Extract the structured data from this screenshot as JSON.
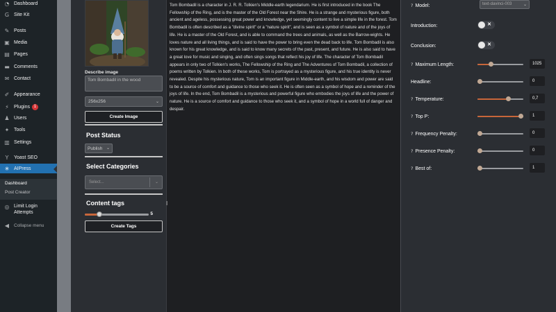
{
  "wp_menu": {
    "items": [
      {
        "label": "Dashboard",
        "icon": "gauge-icon"
      },
      {
        "label": "Site Kit",
        "icon": "g-icon"
      },
      {
        "label": "Posts",
        "icon": "pin-icon"
      },
      {
        "label": "Media",
        "icon": "media-icon"
      },
      {
        "label": "Pages",
        "icon": "page-icon"
      },
      {
        "label": "Comments",
        "icon": "comment-icon"
      },
      {
        "label": "Contact",
        "icon": "mail-icon"
      },
      {
        "label": "Appearance",
        "icon": "brush-icon"
      },
      {
        "label": "Plugins",
        "icon": "plug-icon",
        "badge": "1"
      },
      {
        "label": "Users",
        "icon": "user-icon"
      },
      {
        "label": "Tools",
        "icon": "wrench-icon"
      },
      {
        "label": "Settings",
        "icon": "settings-icon"
      },
      {
        "label": "Yoast SEO",
        "icon": "yoast-icon"
      },
      {
        "label": "AIPress",
        "icon": "aipress-icon"
      }
    ],
    "sub_items": [
      "Dashboard",
      "Post Creator"
    ],
    "limit_login": "Limit Login Attempts",
    "collapse": "Collapse menu"
  },
  "left_panel": {
    "describe_label": "Describe image",
    "describe_value": "Tom Bombadil in the wood",
    "size_value": "256x256",
    "create_image_label": "Create Image",
    "post_status_title": "Post Status",
    "post_status_value": "Publish",
    "categories_title": "Select Categories",
    "categories_placeholder": "Select...",
    "content_tags_title": "Content tags",
    "tags_value": "5",
    "tags_fraction": 0.2,
    "create_tags_label": "Create Tags"
  },
  "content": {
    "text": "Tom Bombadil is a character in J. R. R. Tolkien's Middle-earth legendarium. He is first introduced in the book The Fellowship of the Ring, and is the master of the Old Forest near the Shire. He is a strange and mysterious figure, both ancient and ageless, possessing great power and knowledge, yet seemingly content to live a simple life in the forest. Tom Bombadil is often described as a \"divine spirit\" or a \"nature spirit\", and is seen as a symbol of nature and of the joys of life. He is a master of the Old Forest, and is able to command the trees and animals, as well as the Barrow-wights. He loves nature and all living things, and is said to have the power to bring even the dead back to life. Tom Bombadil is also known for his great knowledge, and is said to know many secrets of the past, present, and future. He is also said to have a great love for music and singing, and often sings songs that reflect his joy of life. The character of Tom Bombadil appears in only two of Tolkien's works, The Fellowship of the Ring and The Adventures of Tom Bombadil, a collection of poems written by Tolkien. In both of these works, Tom is portrayed as a mysterious figure, and his true identity is never revealed. Despite his mysterious nature, Tom is an important figure in Middle-earth, and his wisdom and power are said to be a source of comfort and guidance to those who seek it. He is often seen as a symbol of hope and a reminder of the joys of life. In the end, Tom Bombadil is a mysterious and powerful figure who embodies the joys of life and the power of nature. He is a source of comfort and guidance to those who seek it, and a symbol of hope in a world full of danger and despair."
  },
  "settings": {
    "model_label": "Model:",
    "model_value": "text-davinci-003",
    "introduction_label": "Introduction:",
    "conclusion_label": "Conclusion:",
    "sliders": [
      {
        "label": "Maximum Length:",
        "value": "1025",
        "fraction": 0.27
      },
      {
        "label": "Headline:",
        "value": "0",
        "fraction": 0.0
      },
      {
        "label": "Temperature:",
        "value": "0,7",
        "fraction": 0.7
      },
      {
        "label": "Top P:",
        "value": "1",
        "fraction": 1.0
      },
      {
        "label": "Frequency Penalty:",
        "value": "0",
        "fraction": 0.0
      },
      {
        "label": "Presence Penalty:",
        "value": "0",
        "fraction": 0.0
      },
      {
        "label": "Best of:",
        "value": "1",
        "fraction": 0.0
      }
    ],
    "q_marks": [
      "?",
      "?",
      "?",
      "?",
      "?",
      "?",
      "?",
      "?"
    ]
  },
  "colors": {
    "accent_orange": "#c8663a",
    "wp_blue": "#2271b1",
    "badge_red": "#d63638"
  }
}
